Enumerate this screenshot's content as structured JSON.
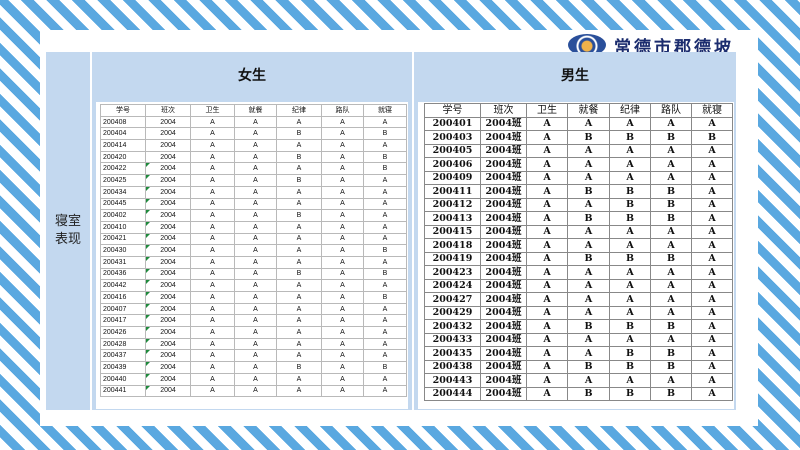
{
  "logo": {
    "text": "常德市郡德坡"
  },
  "row_label": "寝室表现",
  "girls": {
    "title": "女生",
    "columns": [
      "学号",
      "班次",
      "卫生",
      "就餐",
      "纪律",
      "路队",
      "就寝"
    ],
    "rows": [
      [
        "200408",
        "2004",
        "A",
        "A",
        "A",
        "A",
        "A"
      ],
      [
        "200404",
        "2004",
        "A",
        "A",
        "B",
        "A",
        "B"
      ],
      [
        "200414",
        "2004",
        "A",
        "A",
        "A",
        "A",
        "A"
      ],
      [
        "200420",
        "2004",
        "A",
        "A",
        "B",
        "A",
        "B"
      ],
      [
        "200422",
        "2004",
        "A",
        "A",
        "A",
        "A",
        "B"
      ],
      [
        "200425",
        "2004",
        "A",
        "A",
        "B",
        "A",
        "A"
      ],
      [
        "200434",
        "2004",
        "A",
        "A",
        "A",
        "A",
        "A"
      ],
      [
        "200445",
        "2004",
        "A",
        "A",
        "A",
        "A",
        "A"
      ],
      [
        "200402",
        "2004",
        "A",
        "A",
        "B",
        "A",
        "A"
      ],
      [
        "200410",
        "2004",
        "A",
        "A",
        "A",
        "A",
        "A"
      ],
      [
        "200421",
        "2004",
        "A",
        "A",
        "A",
        "A",
        "A"
      ],
      [
        "200430",
        "2004",
        "A",
        "A",
        "A",
        "A",
        "B"
      ],
      [
        "200431",
        "2004",
        "A",
        "A",
        "A",
        "A",
        "A"
      ],
      [
        "200436",
        "2004",
        "A",
        "A",
        "B",
        "A",
        "B"
      ],
      [
        "200442",
        "2004",
        "A",
        "A",
        "A",
        "A",
        "A"
      ],
      [
        "200416",
        "2004",
        "A",
        "A",
        "A",
        "A",
        "B"
      ],
      [
        "200407",
        "2004",
        "A",
        "A",
        "A",
        "A",
        "A"
      ],
      [
        "200417",
        "2004",
        "A",
        "A",
        "A",
        "A",
        "A"
      ],
      [
        "200426",
        "2004",
        "A",
        "A",
        "A",
        "A",
        "A"
      ],
      [
        "200428",
        "2004",
        "A",
        "A",
        "A",
        "A",
        "A"
      ],
      [
        "200437",
        "2004",
        "A",
        "A",
        "A",
        "A",
        "A"
      ],
      [
        "200439",
        "2004",
        "A",
        "A",
        "B",
        "A",
        "B"
      ],
      [
        "200440",
        "2004",
        "A",
        "A",
        "A",
        "A",
        "A"
      ],
      [
        "200441",
        "2004",
        "A",
        "A",
        "A",
        "A",
        "A"
      ]
    ]
  },
  "boys": {
    "title": "男生",
    "columns": [
      "学号",
      "班次",
      "卫生",
      "就餐",
      "纪律",
      "路队",
      "就寝"
    ],
    "rows": [
      [
        "200401",
        "2004班",
        "A",
        "A",
        "A",
        "A",
        "A"
      ],
      [
        "200403",
        "2004班",
        "A",
        "B",
        "B",
        "B",
        "B"
      ],
      [
        "200405",
        "2004班",
        "A",
        "A",
        "A",
        "A",
        "A"
      ],
      [
        "200406",
        "2004班",
        "A",
        "A",
        "A",
        "A",
        "A"
      ],
      [
        "200409",
        "2004班",
        "A",
        "A",
        "A",
        "A",
        "A"
      ],
      [
        "200411",
        "2004班",
        "A",
        "B",
        "B",
        "B",
        "A"
      ],
      [
        "200412",
        "2004班",
        "A",
        "A",
        "B",
        "B",
        "A"
      ],
      [
        "200413",
        "2004班",
        "A",
        "B",
        "B",
        "B",
        "A"
      ],
      [
        "200415",
        "2004班",
        "A",
        "A",
        "A",
        "A",
        "A"
      ],
      [
        "200418",
        "2004班",
        "A",
        "A",
        "A",
        "A",
        "A"
      ],
      [
        "200419",
        "2004班",
        "A",
        "B",
        "B",
        "B",
        "A"
      ],
      [
        "200423",
        "2004班",
        "A",
        "A",
        "A",
        "A",
        "A"
      ],
      [
        "200424",
        "2004班",
        "A",
        "A",
        "A",
        "A",
        "A"
      ],
      [
        "200427",
        "2004班",
        "A",
        "A",
        "A",
        "A",
        "A"
      ],
      [
        "200429",
        "2004班",
        "A",
        "A",
        "A",
        "A",
        "A"
      ],
      [
        "200432",
        "2004班",
        "A",
        "B",
        "B",
        "B",
        "A"
      ],
      [
        "200433",
        "2004班",
        "A",
        "A",
        "A",
        "A",
        "A"
      ],
      [
        "200435",
        "2004班",
        "A",
        "A",
        "B",
        "B",
        "A"
      ],
      [
        "200438",
        "2004班",
        "A",
        "B",
        "B",
        "B",
        "A"
      ],
      [
        "200443",
        "2004班",
        "A",
        "A",
        "A",
        "A",
        "A"
      ],
      [
        "200444",
        "2004班",
        "A",
        "B",
        "B",
        "B",
        "A"
      ]
    ]
  },
  "flagged_girls_rows": [
    4,
    5,
    6,
    7,
    8,
    9,
    10,
    11,
    12,
    13,
    14,
    15,
    16,
    17,
    18,
    19,
    20,
    21,
    22,
    23
  ],
  "colors": {
    "stripe_blue": "#5aa8e0",
    "header_blue": "#c3d8ef",
    "flag_green": "#1e8a3c"
  }
}
